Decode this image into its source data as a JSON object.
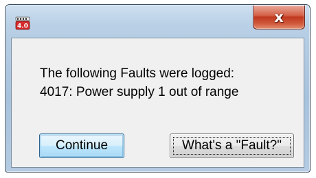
{
  "titlebar": {
    "app_icon": "app-4.0-icon",
    "app_icon_text": "4.0",
    "close_glyph": "x"
  },
  "message": {
    "line1": "The following Faults were logged:",
    "line2": "4017:  Power supply 1 out of range"
  },
  "buttons": {
    "continue_label": "Continue",
    "fault_label": "What's a \"Fault?\""
  },
  "colors": {
    "frame": "#b9d0e6",
    "close_button": "#c1391f",
    "client_bg": "#f0f0f0",
    "default_button": "#bee6fd",
    "app_icon_red": "#d42b2b"
  }
}
